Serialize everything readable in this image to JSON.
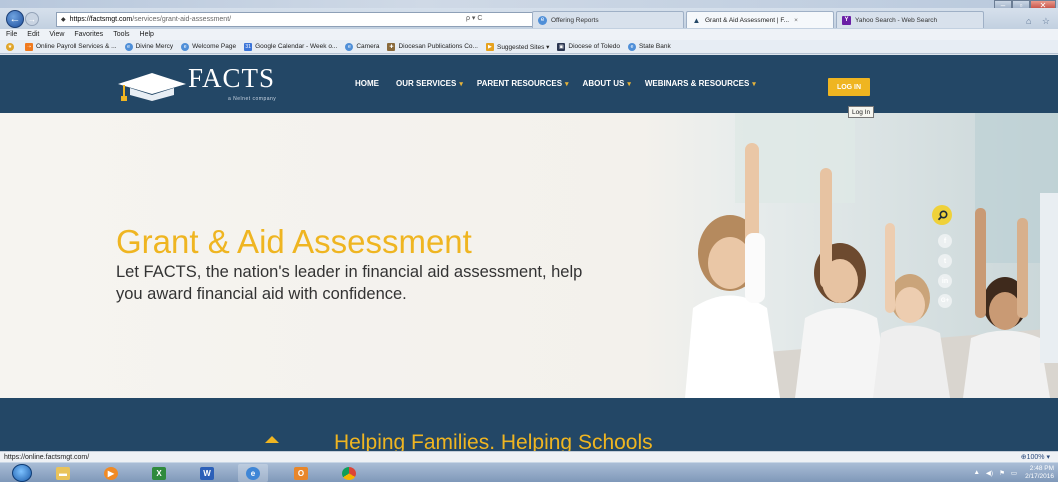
{
  "browser": {
    "url_host": "https://factsmgt.com",
    "url_path": "/services/grant-aid-assessment/",
    "addr_tools": "ρ ▾ C",
    "tabs": [
      {
        "label": "Offering Reports"
      },
      {
        "label": "Grant & Aid Assessment | F...",
        "close": "×"
      },
      {
        "label": "Yahoo Search - Web Search"
      }
    ],
    "menu": [
      "File",
      "Edit",
      "View",
      "Favorites",
      "Tools",
      "Help"
    ],
    "favorites": [
      "Online Payroll Services & ...",
      "Divine Mercy",
      "Welcome Page",
      "Google Calendar - Week o...",
      "Camera",
      "Diocesan Publications Co...",
      "Suggested Sites ▾",
      "Diocese of Toledo",
      "State Bank"
    ],
    "status_url": "https://online.factsmgt.com/",
    "zoom": "100%"
  },
  "site": {
    "logo_text": "FACTS",
    "logo_sub": "a Nelnet company",
    "nav": [
      {
        "label": "HOME",
        "caret": ""
      },
      {
        "label": "OUR SERVICES",
        "caret": "▾"
      },
      {
        "label": "PARENT RESOURCES",
        "caret": "▾"
      },
      {
        "label": "ABOUT US",
        "caret": "▾"
      },
      {
        "label": "WEBINARS & RESOURCES",
        "caret": "▾"
      }
    ],
    "login_label": "LOG IN",
    "login_tooltip": "Log In",
    "hero_title": "Grant & Aid Assessment",
    "hero_lead": "Let FACTS, the nation's leader in financial aid assessment, help you award financial aid with confidence.",
    "band_title": "Helping Families. Helping Schools",
    "social": [
      "f",
      "t",
      "in",
      "G+"
    ]
  },
  "taskbar": {
    "clock_time": "2:48 PM",
    "clock_date": "2/17/2016"
  },
  "colors": {
    "navy": "#234766",
    "gold": "#efb521"
  }
}
